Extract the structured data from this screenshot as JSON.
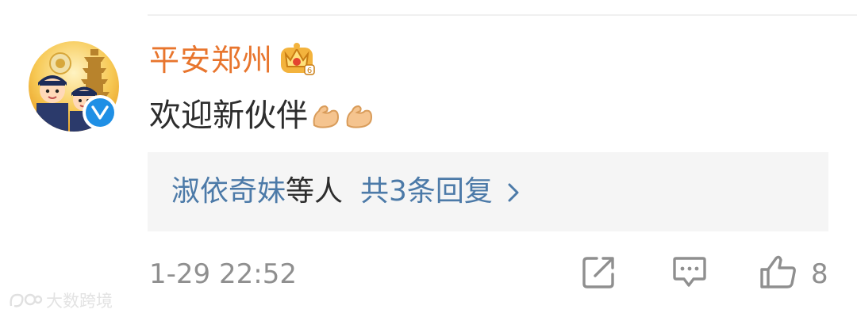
{
  "comment": {
    "username": "平安郑州",
    "username_color": "#e8752d",
    "text": "欢迎新伙伴",
    "emoji": [
      "flexed-biceps-icon",
      "flexed-biceps-icon"
    ],
    "verified": true,
    "badge": "crown-badge-icon"
  },
  "replies": {
    "names": "淑依奇妹",
    "suffix": "等人",
    "count_text": "共3条回复",
    "link_color": "#4c7aa8"
  },
  "footer": {
    "timestamp": "1-29 22:52",
    "like_count": "8",
    "icons": [
      "share-icon",
      "comment-icon",
      "like-icon"
    ]
  },
  "watermark": {
    "text": "大数跨境"
  }
}
